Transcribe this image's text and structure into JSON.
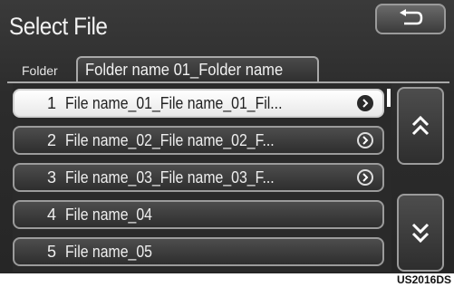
{
  "header": {
    "title": "Select File",
    "back_icon": "back-arrow-icon"
  },
  "folder": {
    "label": "Folder",
    "name": "Folder name 01_Folder name"
  },
  "files": [
    {
      "num": "1",
      "name": "File name_01_File name_01_Fil...",
      "has_arrow": true,
      "selected": true
    },
    {
      "num": "2",
      "name": "File name_02_File name_02_F...",
      "has_arrow": true,
      "selected": false
    },
    {
      "num": "3",
      "name": "File name_03_File name_03_F...",
      "has_arrow": true,
      "selected": false
    },
    {
      "num": "4",
      "name": "File name_04",
      "has_arrow": false,
      "selected": false
    },
    {
      "num": "5",
      "name": "File name_05",
      "has_arrow": false,
      "selected": false
    }
  ],
  "scroll": {
    "up_icon": "double-chevron-up-icon",
    "down_icon": "double-chevron-down-icon"
  },
  "watermark": "US2016DS"
}
